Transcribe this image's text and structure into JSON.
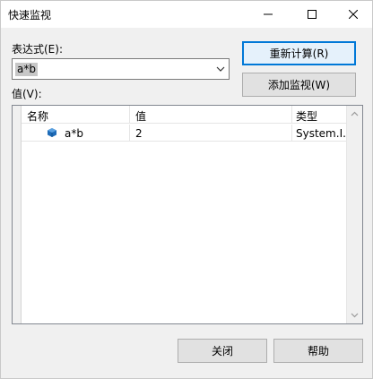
{
  "window": {
    "title": "快速监视"
  },
  "expression": {
    "label": "表达式(E):",
    "value": "a*b"
  },
  "value_section": {
    "label": "值(V):"
  },
  "buttons": {
    "recalculate": "重新计算(R)",
    "add_watch": "添加监视(W)",
    "close": "关闭",
    "help": "帮助"
  },
  "grid": {
    "columns": [
      "名称",
      "值",
      "类型"
    ],
    "rows": [
      {
        "name": "a*b",
        "value": "2",
        "type": "System.I..."
      }
    ]
  },
  "colors": {
    "accent": "#0078d7",
    "object_icon": "#1e6bb8"
  },
  "icons": {
    "row_icon": "object-icon",
    "combo_arrow": "chevron-down-icon"
  }
}
